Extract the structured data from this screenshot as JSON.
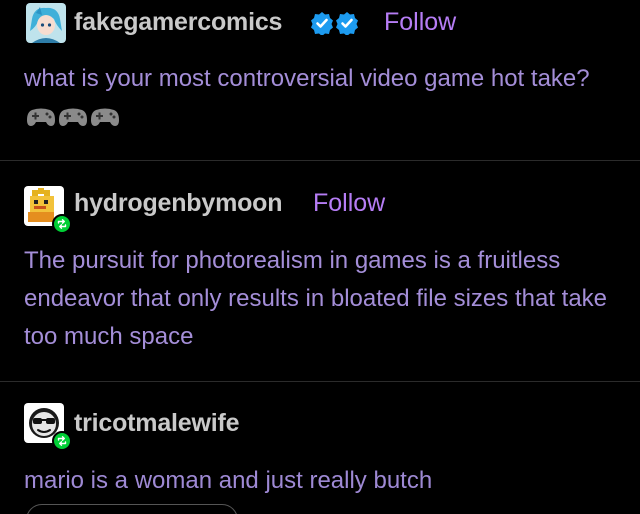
{
  "posts": [
    {
      "username": "fakegamercomics",
      "follow_label": "Follow",
      "body": "what is your most controversial video game hot take?",
      "emoji_icons": [
        "gamepad-icon",
        "gamepad-icon",
        "gamepad-icon"
      ],
      "avatar_icon": "anime-character-avatar",
      "badges": [
        "verified-badge-icon",
        "verified-badge-icon"
      ]
    },
    {
      "username": "hydrogenbymoon",
      "follow_label": "Follow",
      "body": "The pursuit for photorealism in games is a fruitless endeavor that only results in bloated file sizes that take too much space",
      "avatar_icon": "pixel-character-avatar",
      "reblog_icon": "reblog-icon"
    },
    {
      "username": "tricotmalewife",
      "body": "mario is a woman and just really butch",
      "avatar_icon": "sunglasses-face-avatar",
      "reblog_icon": "reblog-icon"
    }
  ],
  "colors": {
    "background": "#000000",
    "username": "#c9c9c9",
    "follow": "#b67df5",
    "body_text": "#a48ed8",
    "verified": "#1d9bf0",
    "reblog": "#00cf35",
    "divider": "#2b2b2b"
  }
}
